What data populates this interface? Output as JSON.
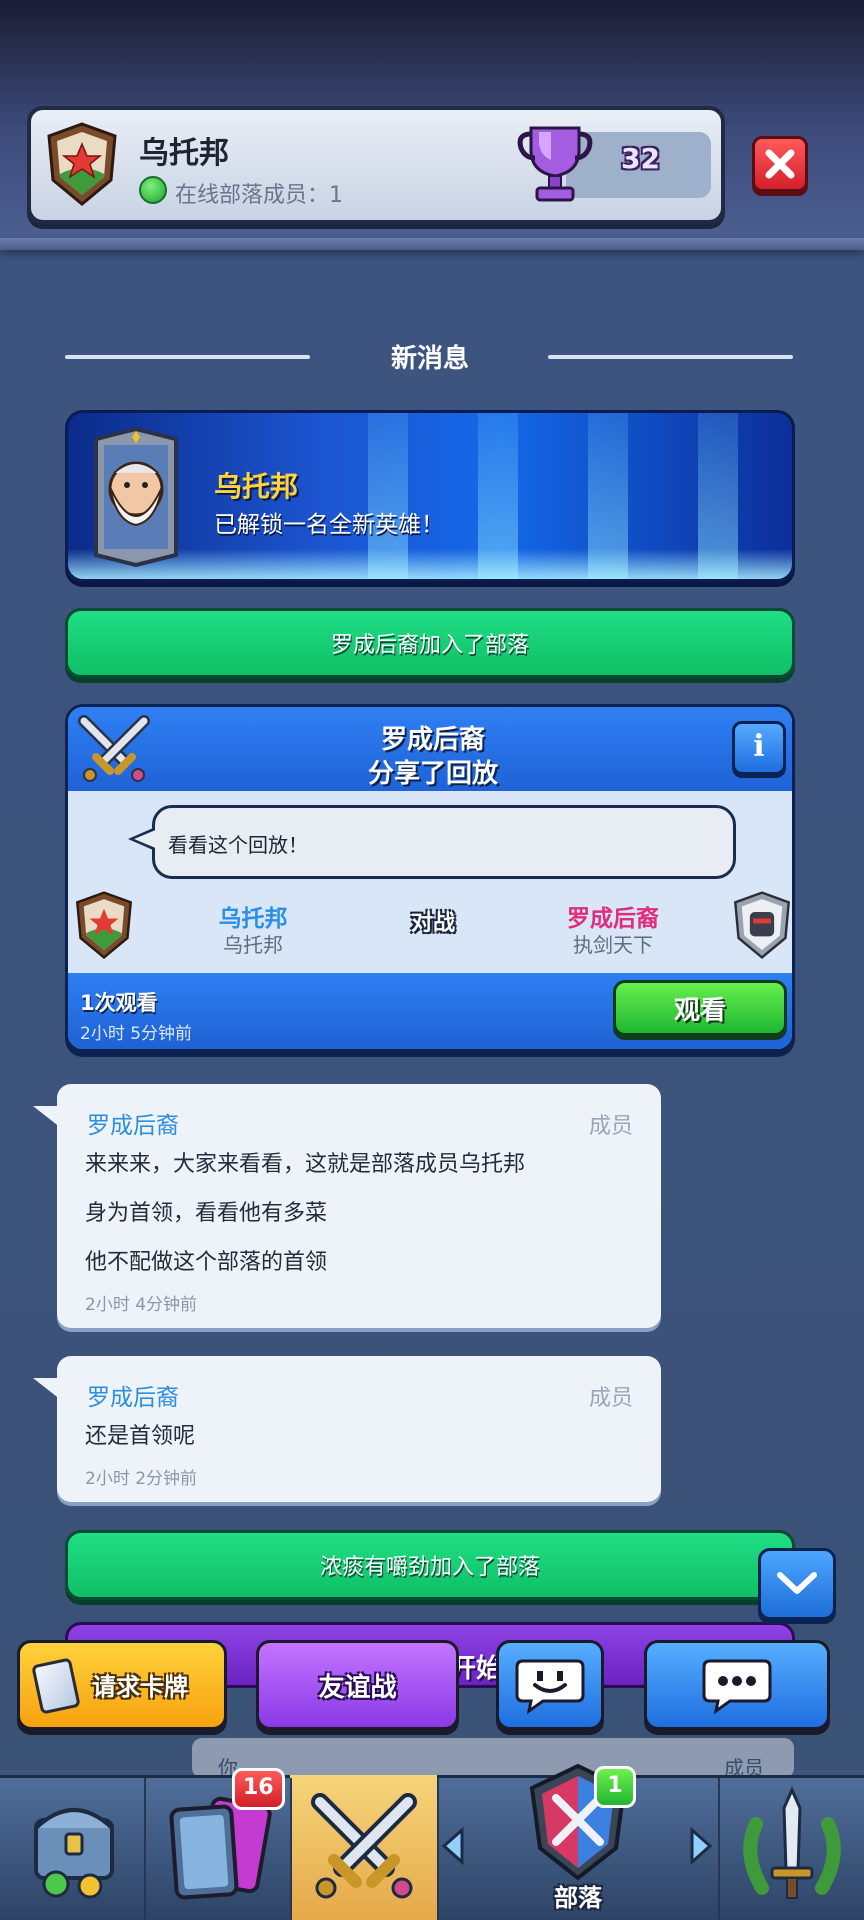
{
  "header": {
    "clan_name": "乌托邦",
    "online_label": "在线部落成员：1",
    "trophies": "32"
  },
  "section": {
    "title": "新消息"
  },
  "hero_banner": {
    "player": "乌托邦",
    "text": "已解锁一名全新英雄！"
  },
  "join_bars": [
    {
      "text": "罗成后裔加入了部落"
    },
    {
      "text": "浓痰有嚼劲加入了部落"
    }
  ],
  "replay": {
    "title_line1": "罗成后裔",
    "title_line2": "分享了回放",
    "info_label": "i",
    "comment": "看看这个回放！",
    "player1": {
      "name": "乌托邦",
      "clan": "乌托邦"
    },
    "vs": "对战",
    "player2": {
      "name": "罗成后裔",
      "clan": "执剑天下"
    },
    "views": "1次观看",
    "time": "2小时 5分钟前",
    "watch_label": "观看"
  },
  "messages": [
    {
      "author": "罗成后裔",
      "role": "成员",
      "lines": [
        "来来来，大家来看看，这就是部落成员乌托邦",
        "身为首领，看看他有多菜",
        "他不配做这个部落的首领"
      ],
      "time": "2小时 4分钟前"
    },
    {
      "author": "罗成后裔",
      "role": "成员",
      "lines": [
        "还是首领呢"
      ],
      "time": "2小时 2分钟前"
    }
  ],
  "purple_bar": {
    "partial_text": "开始"
  },
  "actions": {
    "request_cards": "请求卡牌",
    "friendly_battle": "友谊战"
  },
  "chat_input": {
    "you_label": "你",
    "member_label": "成员"
  },
  "bottom_nav": {
    "cards_badge": "16",
    "clan_badge": "1",
    "clan_label": "部落"
  },
  "colors": {
    "accent_green": "#1fd07a",
    "accent_blue": "#2f80f4",
    "accent_purple": "#8a39e6",
    "link_blue": "#2b8fde",
    "opponent_pink": "#e02c7a",
    "trophy_purple": "#9b4fd8"
  }
}
